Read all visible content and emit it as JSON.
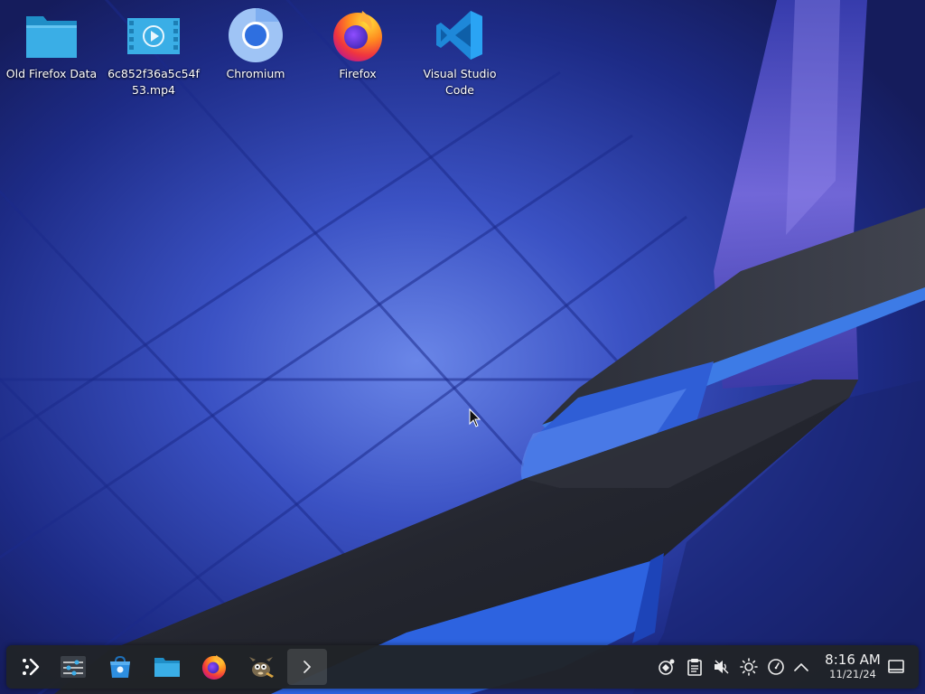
{
  "desktop": {
    "icons": [
      {
        "label": "Old Firefox Data",
        "icon": "folder-icon"
      },
      {
        "label": "6c852f36a5c54f53.mp4",
        "icon": "video-file-icon"
      },
      {
        "label": "Chromium",
        "icon": "chromium-icon"
      },
      {
        "label": "Firefox",
        "icon": "firefox-icon"
      },
      {
        "label": "Visual Studio Code",
        "icon": "vscode-icon"
      }
    ]
  },
  "taskbar": {
    "launchers": [
      {
        "icon": "app-launcher-icon"
      },
      {
        "icon": "system-settings-icon"
      },
      {
        "icon": "discover-store-icon"
      },
      {
        "icon": "file-manager-icon"
      },
      {
        "icon": "firefox-icon"
      },
      {
        "icon": "gimp-icon"
      },
      {
        "icon": "terminal-icon",
        "active": true
      }
    ],
    "tray": [
      {
        "icon": "kde-connect-icon"
      },
      {
        "icon": "clipboard-icon"
      },
      {
        "icon": "volume-muted-icon"
      },
      {
        "icon": "brightness-icon"
      },
      {
        "icon": "power-profile-icon"
      },
      {
        "icon": "show-hidden-icons-chevron"
      }
    ],
    "clock": {
      "time": "8:16 AM",
      "date": "11/21/24"
    },
    "show_desktop": {
      "icon": "show-desktop-icon"
    }
  },
  "colors": {
    "wallpaper_base": "#1e2a7a",
    "accent_blue": "#3d7be6",
    "taskbar_bg": "#202328"
  }
}
